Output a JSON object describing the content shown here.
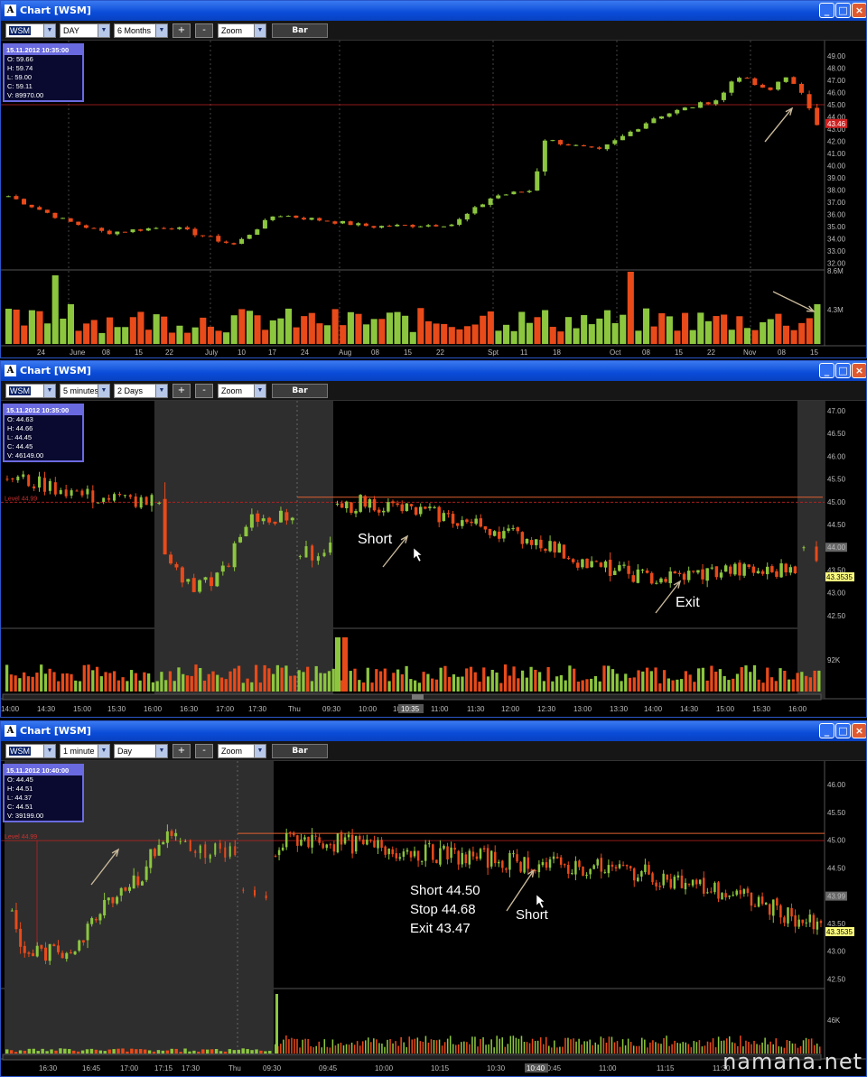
{
  "windows": [
    {
      "title": "Chart [WSM]",
      "symbol": "WSM",
      "interval": "DAY",
      "range": "6 Months",
      "zoom": "Zoom",
      "bar_label": "Bar",
      "plus": "+",
      "minus": "-",
      "ohlc": {
        "date": "15.11.2012 10:35:00",
        "o": "O: 59.66",
        "h": "H: 59.74",
        "l": "L: 59.00",
        "c": "C: 59.11",
        "v": "V: 89970.00"
      },
      "price_ticks": [
        "49.00",
        "48.00",
        "47.00",
        "46.00",
        "45.00",
        "44.00",
        "43.00",
        "42.00",
        "41.00",
        "40.00",
        "39.00",
        "38.00",
        "37.00",
        "36.00",
        "35.00",
        "34.00",
        "33.00",
        "32.00"
      ],
      "price_tag": "43.46",
      "volume_ticks": [
        "8.6M",
        "4.3M"
      ],
      "x_labels": [
        "24",
        "June",
        "08",
        "15",
        "22",
        "July",
        "10",
        "17",
        "24",
        "Aug",
        "08",
        "15",
        "22",
        "Spt",
        "11",
        "18",
        "Oct",
        "08",
        "15",
        "22",
        "Nov",
        "08",
        "15"
      ]
    },
    {
      "title": "Chart [WSM]",
      "symbol": "WSM",
      "interval": "5 minutes",
      "range": "2 Days",
      "zoom": "Zoom",
      "bar_label": "Bar",
      "plus": "+",
      "minus": "-",
      "ohlc": {
        "date": "15.11.2012 10:35:00",
        "o": "O: 44.63",
        "h": "H: 44.66",
        "l": "L: 44.45",
        "c": "C: 44.45",
        "v": "V: 46149.00"
      },
      "price_ticks": [
        "47.00",
        "46.50",
        "46.00",
        "45.50",
        "45.00",
        "44.50",
        "44.00",
        "43.50",
        "43.00",
        "42.50"
      ],
      "level_label": "Level 44.99",
      "price_tag_gray": "44.00",
      "price_tag": "43.3535",
      "volume_ticks": [
        "92K"
      ],
      "annotations": [
        "Short",
        "Exit"
      ],
      "time_cursor": "10:35",
      "x_labels": [
        "14:00",
        "14:30",
        "15:00",
        "15:30",
        "16:00",
        "16:30",
        "17:00",
        "17:30",
        "Thu",
        "09:30",
        "10:00",
        "10:30",
        "11:00",
        "11:30",
        "12:00",
        "12:30",
        "13:00",
        "13:30",
        "14:00",
        "14:30",
        "15:00",
        "15:30",
        "16:00"
      ]
    },
    {
      "title": "Chart [WSM]",
      "symbol": "WSM",
      "interval": "1 minute",
      "range": "Day",
      "zoom": "Zoom",
      "bar_label": "Bar",
      "plus": "+",
      "minus": "-",
      "ohlc": {
        "date": "15.11.2012 10:40:00",
        "o": "O: 44.45",
        "h": "H: 44.51",
        "l": "L: 44.37",
        "c": "C: 44.51",
        "v": "V: 39199.00"
      },
      "price_ticks": [
        "46.00",
        "45.50",
        "45.00",
        "44.50",
        "44.00",
        "43.50",
        "43.00",
        "42.50"
      ],
      "level_label": "Level 44.99",
      "price_tag_gray": "43.99",
      "price_tag": "43.3535",
      "volume_ticks": [
        "46K"
      ],
      "annotations": [
        "Short 44.50",
        "Stop 44.68",
        "Exit 43.47",
        "Short"
      ],
      "time_cursor": "10:40",
      "x_labels": [
        "16:30",
        "16:45",
        "17:00",
        "17:15",
        "17:30",
        "Thu",
        "09:30",
        "09:45",
        "10:00",
        "10:15",
        "10:30",
        "10:45",
        "11:00",
        "11:15",
        "11:30"
      ]
    }
  ],
  "watermark": "namana.net",
  "colors": {
    "up": "#8cc63f",
    "down": "#e84a1a",
    "level": "#c02020",
    "grid": "#2a2a2a",
    "shade": "#2e2e2e",
    "arrow": "#c8b89a"
  }
}
